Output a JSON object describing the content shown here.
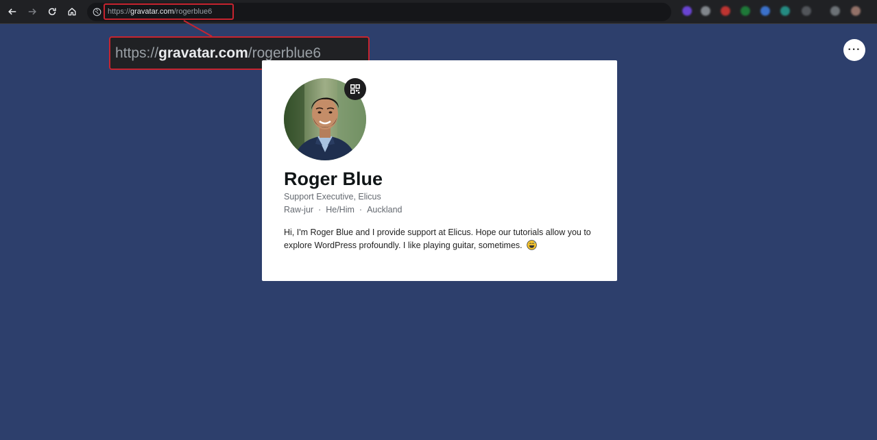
{
  "browser": {
    "url_scheme": "https://",
    "url_host": "gravatar.com",
    "url_path": "/rogerblue6",
    "icons": [
      "back-arrow-icon",
      "forward-arrow-icon",
      "reload-icon",
      "home-icon",
      "site-info-icon"
    ],
    "extension_icons": [
      "extension-icon",
      "extension-icon",
      "extension-icon",
      "extension-icon",
      "extension-icon",
      "extension-icon",
      "extension-icon",
      "extension-icon",
      "extension-icon"
    ]
  },
  "callout": {
    "url_scheme": "https://",
    "url_host": "gravatar.com",
    "url_path": "/rogerblue6",
    "border_color": "#c8242f"
  },
  "page": {
    "more_button_label": "···",
    "background_color": "#2d3f6c"
  },
  "profile": {
    "name": "Roger Blue",
    "job_title": "Support Executive, Elicus",
    "pronunciation": "Raw-jur",
    "pronouns": "He/Him",
    "location": "Auckland",
    "separator": "·",
    "bio": "Hi, I'm Roger Blue and I provide support at Elicus. Hope our tutorials allow you to explore WordPress profoundly. I like playing guitar, sometimes.",
    "bio_emoji": "grinning-sweat-emoji",
    "qr_icon": "qr-code-icon",
    "avatar": "profile-photo"
  }
}
